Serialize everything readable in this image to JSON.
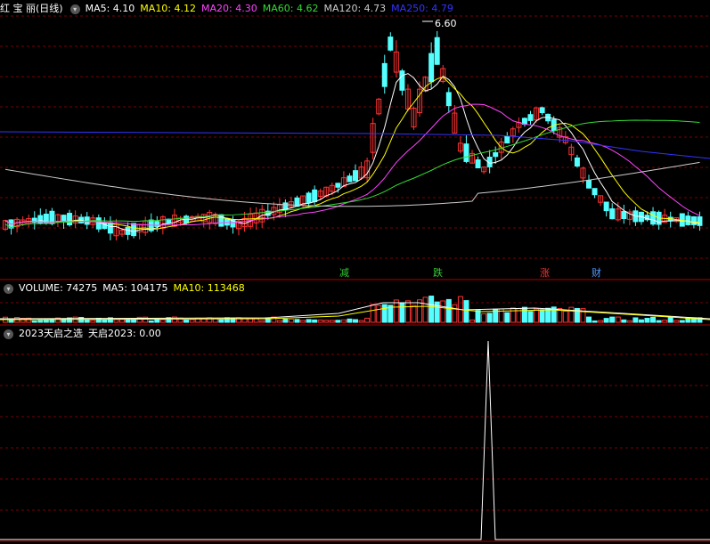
{
  "main_header": {
    "stock_name": "红 宝 丽(日线)",
    "ma_items": [
      {
        "label": "MA5: 4.10",
        "color": "#ffffff"
      },
      {
        "label": "MA10: 4.12",
        "color": "#ffff00"
      },
      {
        "label": "MA20: 4.30",
        "color": "#ff44ff"
      },
      {
        "label": "MA60: 4.62",
        "color": "#33dd33"
      },
      {
        "label": "MA120: 4.73",
        "color": "#cccccc"
      },
      {
        "label": "MA250: 4.79",
        "color": "#3333ff"
      }
    ]
  },
  "volume_header": {
    "items": [
      {
        "label": "VOLUME: 74275",
        "color": "#ffffff"
      },
      {
        "label": "MA5: 104175",
        "color": "#ffffff"
      },
      {
        "label": "MA10: 113468",
        "color": "#ffff00"
      }
    ]
  },
  "indicator_header": {
    "name": "2023天启之选",
    "value_label": "天启2023: 0.00"
  },
  "chart_data": {
    "type": "candlestick",
    "high_marker": "6.60",
    "signal_tags": [
      {
        "text": "减",
        "color": "#33cc33"
      },
      {
        "text": "跌",
        "color": "#33cc33"
      },
      {
        "text": "涨",
        "color": "#ff3333"
      },
      {
        "text": "财",
        "color": "#5599ff"
      }
    ],
    "colors": {
      "up": "#ff3232",
      "down": "#54ffff",
      "grid": "#7a0000",
      "divider": "#b00000"
    }
  }
}
